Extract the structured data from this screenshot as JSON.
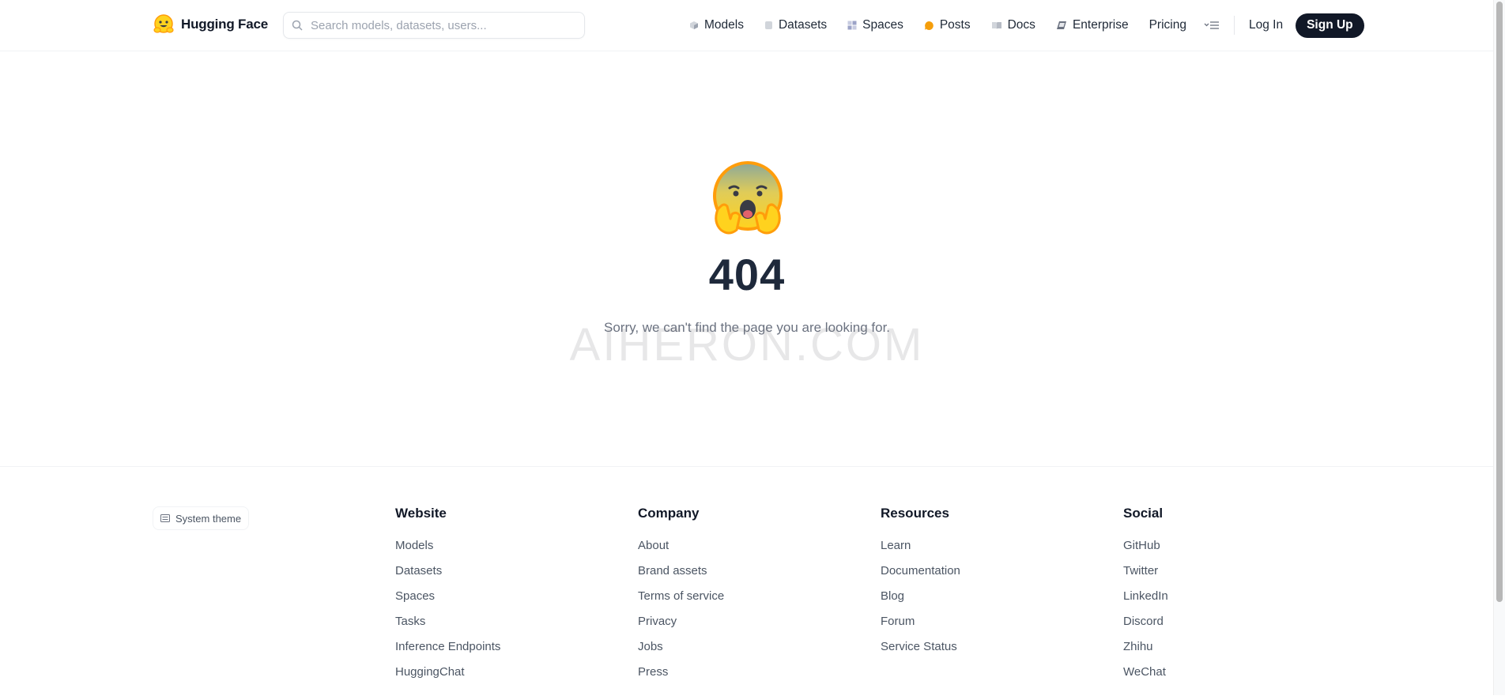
{
  "header": {
    "brand": "Hugging Face",
    "search_placeholder": "Search models, datasets, users...",
    "nav": [
      {
        "label": "Models",
        "icon": "models-cube-icon"
      },
      {
        "label": "Datasets",
        "icon": "datasets-db-icon"
      },
      {
        "label": "Spaces",
        "icon": "spaces-grid-icon"
      },
      {
        "label": "Posts",
        "icon": "posts-bubble-icon"
      },
      {
        "label": "Docs",
        "icon": "docs-book-icon"
      },
      {
        "label": "Enterprise",
        "icon": "enterprise-icon"
      },
      {
        "label": "Pricing"
      }
    ],
    "login": "Log In",
    "signup": "Sign Up"
  },
  "main": {
    "error_code": "404",
    "message": "Sorry, we can't find the page you are looking for.",
    "watermark": "AIHERON.COM"
  },
  "footer": {
    "theme_label": "System theme",
    "columns": [
      {
        "title": "Website",
        "links": [
          "Models",
          "Datasets",
          "Spaces",
          "Tasks",
          "Inference Endpoints",
          "HuggingChat"
        ]
      },
      {
        "title": "Company",
        "links": [
          "About",
          "Brand assets",
          "Terms of service",
          "Privacy",
          "Jobs",
          "Press"
        ]
      },
      {
        "title": "Resources",
        "links": [
          "Learn",
          "Documentation",
          "Blog",
          "Forum",
          "Service Status"
        ]
      },
      {
        "title": "Social",
        "links": [
          "GitHub",
          "Twitter",
          "LinkedIn",
          "Discord",
          "Zhihu",
          "WeChat"
        ]
      }
    ]
  },
  "colors": {
    "primary_text": "#111827",
    "signup_bg": "#111827",
    "muted_text": "#6b7280",
    "error_code": "#1e293b",
    "emoji_yellow": "#FFD21E",
    "emoji_orange": "#FF9D0B"
  }
}
